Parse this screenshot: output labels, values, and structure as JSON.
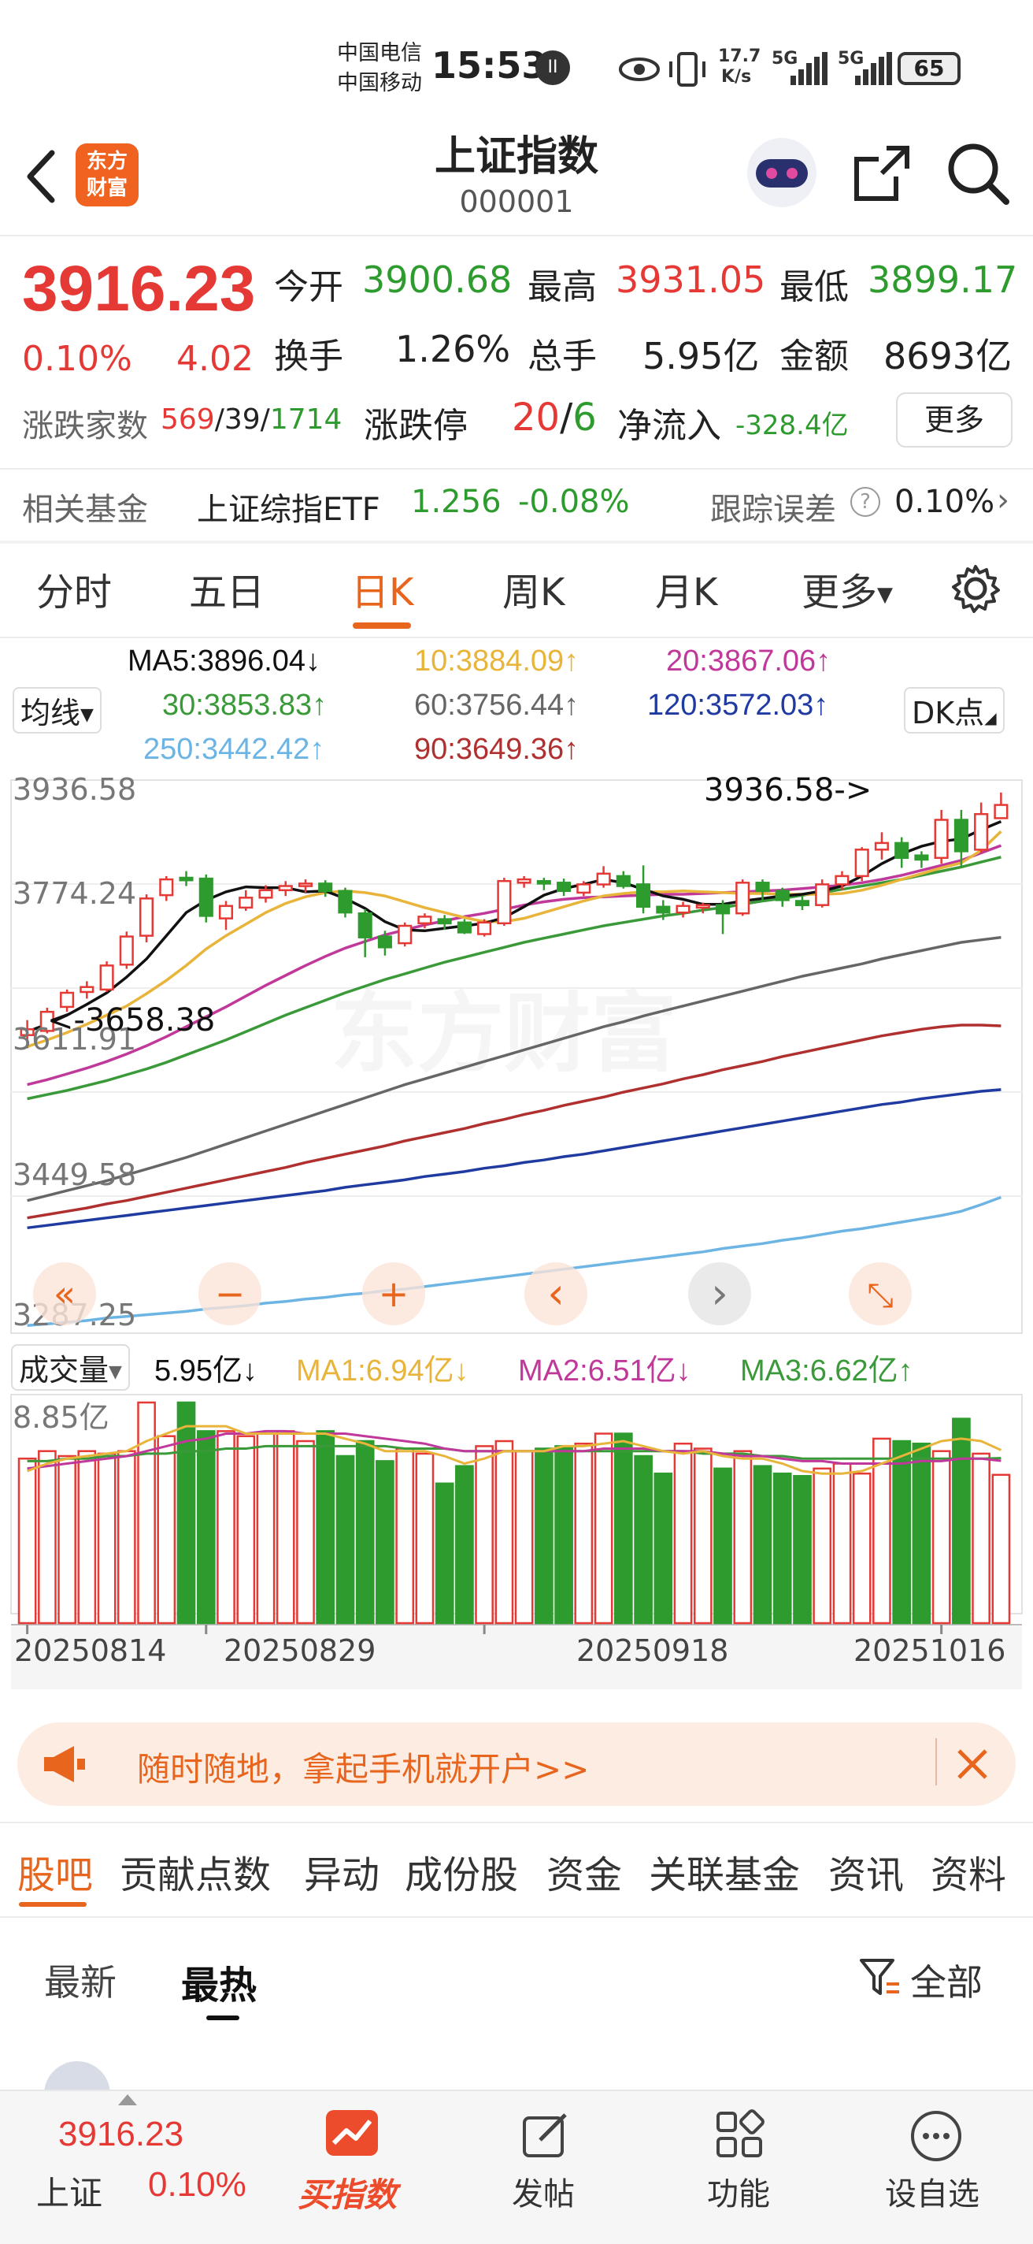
{
  "status_bar": {
    "operator1": "中国电信",
    "operator2": "中国移动",
    "time": "15:53",
    "net_speed_value": "17.7",
    "net_speed_unit": "K/s",
    "signal1": "5G",
    "signal2": "5G",
    "battery": "65"
  },
  "header": {
    "logo_line1": "东方",
    "logo_line2": "财富",
    "title": "上证指数",
    "code": "000001"
  },
  "quote": {
    "price": "3916.23",
    "change_pct": "0.10%",
    "change_abs": "4.02",
    "open_label": "今开",
    "open": "3900.68",
    "high_label": "最高",
    "high": "3931.05",
    "low_label": "最低",
    "low": "3899.17",
    "turnover_label": "换手",
    "turnover": "1.26%",
    "volume_label": "总手",
    "volume": "5.95亿",
    "amount_label": "金额",
    "amount": "8693亿",
    "breadth_label": "涨跌家数",
    "breadth_up": "569",
    "breadth_sep1": "/",
    "breadth_flat": "39",
    "breadth_sep2": "/",
    "breadth_down": "1714",
    "limit_label": "涨跌停",
    "limit_up": "20",
    "limit_sep": "/",
    "limit_down": "6",
    "netflow_label": "净流入",
    "netflow": "-328.4亿",
    "more_button": "更多"
  },
  "fund_row": {
    "label": "相关基金",
    "name": "上证综指ETF",
    "price": "1.256",
    "change": "-0.08%",
    "err_label": "跟踪误差",
    "err_value": "0.10%"
  },
  "period_tabs": [
    "分时",
    "五日",
    "日K",
    "周K",
    "月K",
    "更多"
  ],
  "active_period": "日K",
  "ma_legend": {
    "selector": "均线",
    "ma5": "MA5:3896.04",
    "ma10": "10:3884.09",
    "ma20": "20:3867.06",
    "ma30": "30:3853.83",
    "ma60": "60:3756.44",
    "ma120": "120:3572.03",
    "ma250": "250:3442.42",
    "ma90": "90:3649.36",
    "dk_button": "DK点",
    "arrow_up": "↑",
    "arrow_down": "↓"
  },
  "colors": {
    "up": "#e53935",
    "down": "#2e9b2e",
    "ma5": "#111111",
    "ma10": "#e8b53a",
    "ma20": "#c0389a",
    "ma30": "#3a9a3a",
    "ma60": "#666666",
    "ma90": "#b03030",
    "ma120": "#1f3aa0",
    "ma250": "#6cb4e4",
    "accent": "#e8651e"
  },
  "chart_axis": {
    "y_labels": [
      "3936.58",
      "3774.24",
      "3611.91",
      "3449.58",
      "3287.25"
    ],
    "max_marker": "3936.58->",
    "min_marker": "<-3658.38",
    "dates": [
      "20250814",
      "20250829",
      "20250918",
      "20251016"
    ],
    "vol_max_label": "8.85亿",
    "watermark": "东方财富"
  },
  "chart_controls": [
    "«",
    "−",
    "+",
    "‹",
    "›",
    "⤡"
  ],
  "volume_legend": {
    "selector": "成交量",
    "vol": "5.95亿",
    "ma1": "MA1:6.94亿",
    "ma2": "MA2:6.51亿",
    "ma3": "MA3:6.62亿"
  },
  "chart_data": {
    "type": "candlestick",
    "y_range": [
      3287.25,
      3936.58
    ],
    "candles": [
      [
        3638,
        3645,
        3622,
        3656
      ],
      [
        3643,
        3666,
        3640,
        3671
      ],
      [
        3672,
        3689,
        3666,
        3693
      ],
      [
        3690,
        3696,
        3682,
        3703
      ],
      [
        3693,
        3722,
        3690,
        3727
      ],
      [
        3723,
        3757,
        3718,
        3763
      ],
      [
        3758,
        3803,
        3750,
        3808
      ],
      [
        3807,
        3826,
        3800,
        3830
      ],
      [
        3828,
        3825,
        3818,
        3836
      ],
      [
        3827,
        3782,
        3774,
        3832
      ],
      [
        3779,
        3794,
        3765,
        3800
      ],
      [
        3792,
        3804,
        3788,
        3813
      ],
      [
        3804,
        3813,
        3798,
        3819
      ],
      [
        3813,
        3818,
        3806,
        3824
      ],
      [
        3818,
        3821,
        3810,
        3826
      ],
      [
        3821,
        3812,
        3805,
        3825
      ],
      [
        3812,
        3786,
        3780,
        3816
      ],
      [
        3785,
        3756,
        3732,
        3790
      ],
      [
        3757,
        3744,
        3734,
        3764
      ],
      [
        3749,
        3770,
        3745,
        3774
      ],
      [
        3773,
        3781,
        3767,
        3785
      ],
      [
        3778,
        3773,
        3765,
        3783
      ],
      [
        3774,
        3762,
        3760,
        3778
      ],
      [
        3760,
        3774,
        3757,
        3778
      ],
      [
        3773,
        3824,
        3770,
        3828
      ],
      [
        3822,
        3826,
        3816,
        3830
      ],
      [
        3824,
        3821,
        3813,
        3828
      ],
      [
        3822,
        3812,
        3806,
        3827
      ],
      [
        3810,
        3820,
        3806,
        3824
      ],
      [
        3820,
        3833,
        3816,
        3842
      ],
      [
        3830,
        3818,
        3815,
        3836
      ],
      [
        3820,
        3793,
        3785,
        3843
      ],
      [
        3793,
        3786,
        3777,
        3801
      ],
      [
        3786,
        3794,
        3780,
        3799
      ],
      [
        3792,
        3795,
        3785,
        3798
      ],
      [
        3795,
        3785,
        3760,
        3801
      ],
      [
        3785,
        3822,
        3782,
        3826
      ],
      [
        3822,
        3812,
        3800,
        3826
      ],
      [
        3812,
        3801,
        3793,
        3816
      ],
      [
        3800,
        3795,
        3789,
        3806
      ],
      [
        3795,
        3820,
        3792,
        3826
      ],
      [
        3820,
        3830,
        3813,
        3836
      ],
      [
        3830,
        3862,
        3824,
        3865
      ],
      [
        3862,
        3870,
        3850,
        3883
      ],
      [
        3870,
        3852,
        3840,
        3877
      ],
      [
        3855,
        3850,
        3840,
        3860
      ],
      [
        3852,
        3898,
        3845,
        3910
      ],
      [
        3898,
        3860,
        3840,
        3910
      ],
      [
        3862,
        3905,
        3858,
        3919
      ],
      [
        3900,
        3916,
        3899,
        3931
      ]
    ],
    "ma5": [
      3642,
      3651,
      3662,
      3675,
      3689,
      3708,
      3730,
      3758,
      3786,
      3801,
      3811,
      3817,
      3816,
      3816,
      3811,
      3812,
      3803,
      3791,
      3775,
      3765,
      3764,
      3767,
      3770,
      3773,
      3780,
      3793,
      3807,
      3815,
      3820,
      3826,
      3822,
      3814,
      3806,
      3802,
      3796,
      3796,
      3800,
      3803,
      3806,
      3808,
      3812,
      3818,
      3830,
      3845,
      3857,
      3866,
      3872,
      3875,
      3886,
      3896
    ],
    "ma10": [
      3624,
      3632,
      3641,
      3651,
      3662,
      3673,
      3688,
      3704,
      3722,
      3742,
      3758,
      3772,
      3786,
      3797,
      3805,
      3810,
      3812,
      3810,
      3806,
      3799,
      3792,
      3786,
      3780,
      3775,
      3775,
      3779,
      3786,
      3793,
      3800,
      3806,
      3809,
      3811,
      3811,
      3812,
      3811,
      3810,
      3809,
      3809,
      3808,
      3808,
      3808,
      3809,
      3813,
      3819,
      3826,
      3833,
      3840,
      3846,
      3861,
      3884
    ],
    "ma20": [
      3578,
      3584,
      3591,
      3598,
      3606,
      3615,
      3625,
      3636,
      3648,
      3660,
      3672,
      3685,
      3698,
      3710,
      3722,
      3733,
      3743,
      3751,
      3759,
      3765,
      3771,
      3776,
      3781,
      3785,
      3790,
      3795,
      3799,
      3802,
      3804,
      3805,
      3806,
      3807,
      3808,
      3808,
      3809,
      3810,
      3811,
      3812,
      3813,
      3815,
      3817,
      3819,
      3822,
      3826,
      3831,
      3837,
      3843,
      3849,
      3858,
      3867
    ],
    "ma30": [
      3561,
      3566,
      3571,
      3577,
      3583,
      3590,
      3597,
      3605,
      3614,
      3623,
      3632,
      3642,
      3652,
      3662,
      3671,
      3680,
      3689,
      3697,
      3705,
      3712,
      3719,
      3726,
      3732,
      3738,
      3744,
      3750,
      3755,
      3760,
      3765,
      3770,
      3774,
      3778,
      3782,
      3785,
      3789,
      3792,
      3796,
      3800,
      3803,
      3807,
      3810,
      3814,
      3818,
      3822,
      3826,
      3831,
      3836,
      3841,
      3847,
      3853
    ],
    "ma60": [
      3438,
      3444,
      3450,
      3456,
      3462,
      3469,
      3476,
      3483,
      3490,
      3498,
      3506,
      3514,
      3522,
      3530,
      3538,
      3546,
      3554,
      3562,
      3570,
      3578,
      3585,
      3592,
      3599,
      3606,
      3613,
      3620,
      3627,
      3634,
      3641,
      3648,
      3654,
      3661,
      3667,
      3673,
      3679,
      3685,
      3691,
      3697,
      3703,
      3709,
      3714,
      3719,
      3724,
      3730,
      3735,
      3740,
      3745,
      3750,
      3753,
      3756
    ],
    "ma90": [
      3417,
      3421,
      3425,
      3429,
      3434,
      3438,
      3443,
      3448,
      3453,
      3458,
      3463,
      3468,
      3473,
      3478,
      3484,
      3489,
      3494,
      3499,
      3504,
      3510,
      3515,
      3520,
      3525,
      3531,
      3536,
      3542,
      3547,
      3553,
      3558,
      3563,
      3569,
      3574,
      3579,
      3585,
      3590,
      3596,
      3601,
      3606,
      3612,
      3617,
      3622,
      3627,
      3632,
      3637,
      3641,
      3645,
      3648,
      3650,
      3650,
      3649
    ],
    "ma120": [
      3405,
      3408,
      3411,
      3414,
      3417,
      3420,
      3423,
      3426,
      3429,
      3432,
      3435,
      3438,
      3441,
      3444,
      3447,
      3450,
      3454,
      3457,
      3460,
      3463,
      3467,
      3470,
      3473,
      3477,
      3480,
      3484,
      3487,
      3491,
      3494,
      3498,
      3502,
      3506,
      3510,
      3514,
      3518,
      3522,
      3526,
      3530,
      3534,
      3538,
      3542,
      3546,
      3550,
      3554,
      3557,
      3561,
      3564,
      3567,
      3570,
      3572
    ],
    "ma250": [
      3287,
      3289,
      3291,
      3293,
      3296,
      3298,
      3300,
      3302,
      3304,
      3307,
      3309,
      3311,
      3314,
      3316,
      3319,
      3321,
      3324,
      3326,
      3329,
      3331,
      3334,
      3337,
      3340,
      3343,
      3346,
      3349,
      3352,
      3355,
      3358,
      3361,
      3364,
      3367,
      3370,
      3373,
      3376,
      3380,
      3383,
      3386,
      3390,
      3393,
      3397,
      3401,
      3404,
      3408,
      3412,
      3416,
      3420,
      3425,
      3433,
      3442
    ],
    "volume_range": [
      0,
      8.85
    ],
    "volume": [
      6.6,
      6.9,
      6.7,
      6.9,
      6.8,
      6.9,
      8.85,
      7.5,
      8.85,
      7.7,
      7.7,
      7.5,
      7.6,
      7.7,
      7.3,
      7.7,
      6.7,
      7.3,
      6.5,
      7.0,
      6.8,
      5.6,
      6.3,
      7.1,
      7.3,
      6.9,
      7.0,
      7.1,
      7.2,
      7.6,
      7.6,
      6.7,
      6.0,
      7.2,
      7.0,
      6.2,
      6.9,
      6.3,
      6.0,
      5.9,
      6.2,
      6.4,
      6.0,
      7.4,
      7.3,
      7.2,
      6.9,
      8.2,
      6.8,
      5.95
    ],
    "vol_ma1": [
      6.1,
      6.4,
      6.6,
      6.7,
      6.8,
      6.9,
      7.3,
      7.6,
      7.9,
      7.9,
      7.9,
      7.6,
      7.6,
      7.6,
      7.6,
      7.6,
      7.4,
      7.2,
      6.9,
      6.9,
      6.9,
      6.7,
      6.4,
      6.6,
      6.9,
      6.9,
      6.9,
      7.1,
      7.1,
      7.2,
      7.3,
      7.1,
      6.9,
      6.8,
      6.9,
      6.7,
      6.6,
      6.6,
      6.4,
      6.1,
      6.0,
      6.0,
      6.1,
      6.4,
      6.7,
      7.0,
      7.3,
      7.4,
      7.3,
      6.94
    ],
    "vol_ma2": [
      6.2,
      6.3,
      6.4,
      6.5,
      6.6,
      6.7,
      6.9,
      7.1,
      7.3,
      7.4,
      7.6,
      7.6,
      7.7,
      7.7,
      7.6,
      7.6,
      7.6,
      7.5,
      7.4,
      7.3,
      7.2,
      7.0,
      6.9,
      6.9,
      6.9,
      6.9,
      6.9,
      6.9,
      6.9,
      7.0,
      7.0,
      7.0,
      6.9,
      6.9,
      6.9,
      6.8,
      6.7,
      6.7,
      6.6,
      6.5,
      6.5,
      6.4,
      6.4,
      6.4,
      6.4,
      6.5,
      6.5,
      6.6,
      6.6,
      6.51
    ],
    "vol_ma3": [
      6.5,
      6.5,
      6.6,
      6.6,
      6.7,
      6.7,
      6.8,
      6.8,
      6.9,
      6.9,
      7.0,
      7.0,
      7.1,
      7.1,
      7.1,
      7.1,
      7.1,
      7.1,
      7.1,
      7.0,
      7.0,
      7.0,
      6.9,
      6.9,
      6.9,
      6.9,
      6.9,
      6.9,
      6.9,
      6.9,
      6.9,
      6.9,
      6.9,
      6.9,
      6.8,
      6.8,
      6.8,
      6.7,
      6.7,
      6.6,
      6.6,
      6.6,
      6.6,
      6.6,
      6.6,
      6.6,
      6.6,
      6.6,
      6.6,
      6.62
    ],
    "date_labels": [
      "20250814",
      "20250829",
      "20250918",
      "20251016"
    ],
    "date_indices": [
      0,
      9,
      23,
      46
    ]
  },
  "banner": {
    "text": "随时随地，拿起手机就开户>>"
  },
  "info_tabs": [
    "股吧",
    "贡献点数",
    "异动",
    "成份股",
    "资金",
    "关联基金",
    "资讯",
    "资料"
  ],
  "sort_tabs": {
    "latest": "最新",
    "hot": "最热",
    "filter": "全部"
  },
  "bottom_bar": {
    "price": "3916.23",
    "name": "上证",
    "change": "0.10%",
    "buy_index": "买指数",
    "post": "发帖",
    "features": "功能",
    "watchlist": "设自选"
  }
}
